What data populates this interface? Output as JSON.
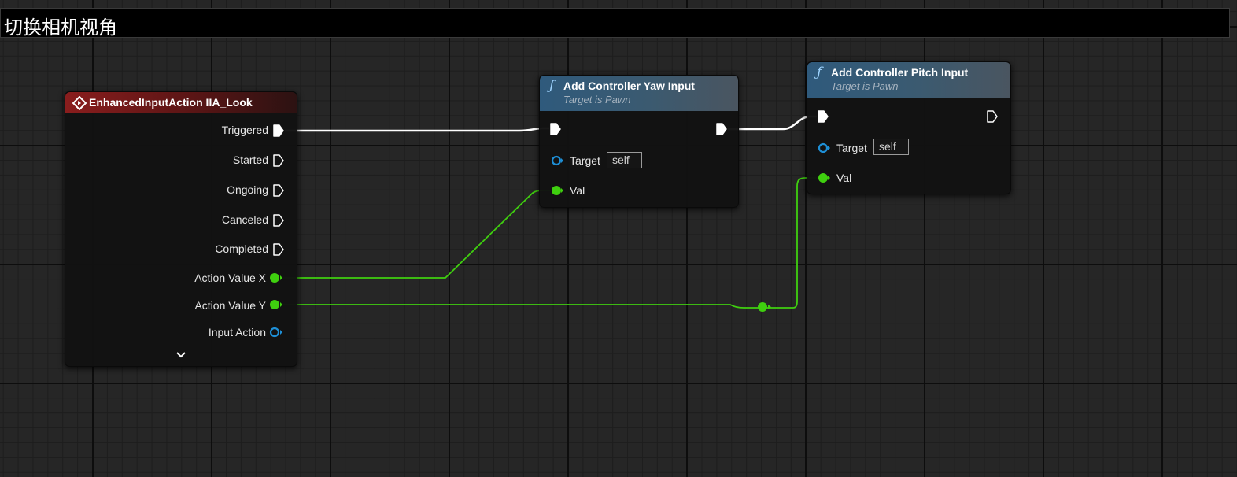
{
  "comment": {
    "title": "切换相机视角"
  },
  "event_node": {
    "title": "EnhancedInputAction IIA_Look",
    "pins": {
      "triggered": "Triggered",
      "started": "Started",
      "ongoing": "Ongoing",
      "canceled": "Canceled",
      "completed": "Completed",
      "action_value_x": "Action Value X",
      "action_value_y": "Action Value Y",
      "input_action": "Input Action"
    }
  },
  "yaw_node": {
    "title": "Add Controller Yaw Input",
    "subtitle": "Target is Pawn",
    "target_label": "Target",
    "target_value": "self",
    "val_label": "Val"
  },
  "pitch_node": {
    "title": "Add Controller Pitch Input",
    "subtitle": "Target is Pawn",
    "target_label": "Target",
    "target_value": "self",
    "val_label": "Val"
  },
  "colors": {
    "exec_wire": "#ffffff",
    "float_wire": "#3fcf0f",
    "object_pin": "#1e8fd6",
    "event_header": "#8a1d1d",
    "function_header": "#2f5a7c"
  },
  "icons": {
    "event": "event-diamond-icon",
    "function": "function-f-icon",
    "expand": "chevron-down-icon"
  }
}
